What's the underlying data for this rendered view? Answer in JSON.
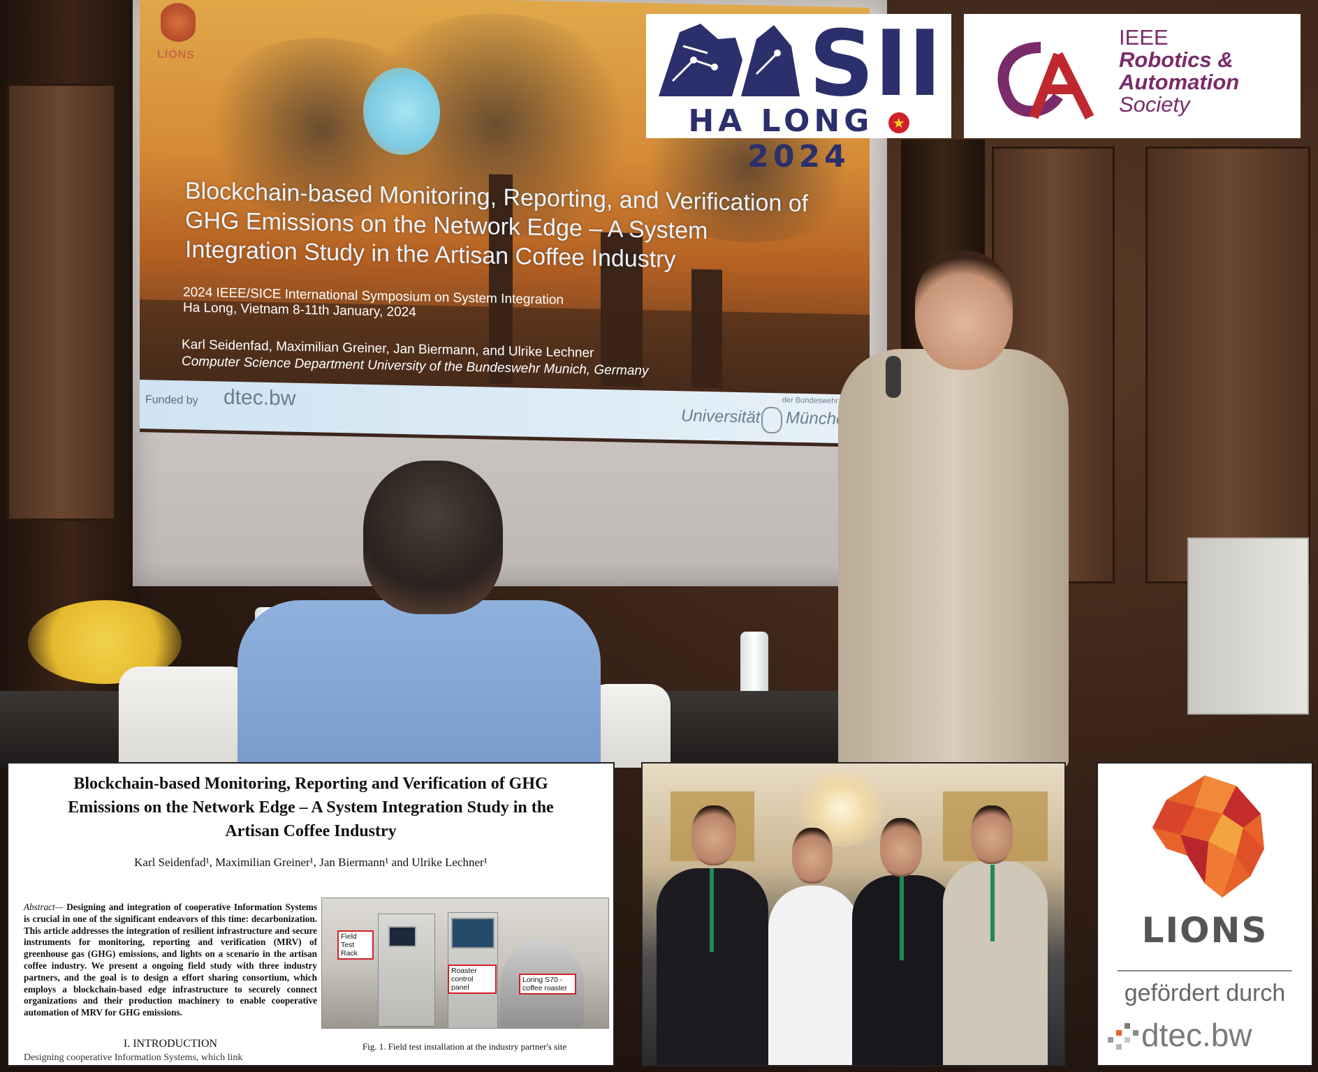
{
  "slide": {
    "logo_text": "LIONS",
    "title_lines": [
      "Blockchain-based Monitoring, Reporting, and Verification of",
      "GHG Emissions on the Network Edge – A System",
      "Integration Study in the Artisan Coffee Industry"
    ],
    "event_lines": [
      "2024 IEEE/SICE International Symposium on System Integration",
      "Ha Long, Vietnam 8-11th January, 2024"
    ],
    "authors": "Karl Seidenfad, Maximilian Greiner, Jan Biermann, and Ulrike Lechner",
    "affiliation": "Computer Science Department University of the Bundeswehr Munich, Germany",
    "funded_by": "Funded by",
    "funder_name": "dtec.bw",
    "university_left": "Universität",
    "university_right": "München",
    "university_top": "der Bundeswehr"
  },
  "sii_logo": {
    "mark_text": "SII",
    "place": "HA LONG",
    "year": "2024"
  },
  "ras_logo": {
    "lines": [
      "IEEE",
      "Robotics &",
      "Automation",
      "Society"
    ]
  },
  "paper": {
    "title_lines": [
      "Blockchain-based Monitoring, Reporting and Verification of GHG",
      "Emissions on the Network Edge – A System Integration Study in the",
      "Artisan Coffee Industry"
    ],
    "authors": "Karl Seidenfad¹, Maximilian Greiner¹, Jan Biermann¹ and Ulrike Lechner¹",
    "abstract_label": "Abstract—",
    "abstract_text": "Designing and integration of cooperative Information Systems is crucial in one of the significant endeavors of this time: decarbonization. This article addresses the integration of resilient infrastructure and secure instruments for monitoring, reporting and verification (MRV) of greenhouse gas (GHG) emissions, and lights on a scenario in the artisan coffee industry. We present a ongoing field study with three industry partners, and the goal is to design a effort sharing consortium, which employs a blockchain-based edge infrastructure to securely connect organizations and their production machinery to enable cooperative automation of MRV for GHG emissions.",
    "section_heading": "I. INTRODUCTION",
    "trailing_text": "Designing cooperative Information Systems, which link",
    "figure_labels": [
      "Field Test Rack",
      "Roaster control panel",
      "Loring S70 - coffee roaster"
    ],
    "figure_caption": "Fig. 1.   Field test installation at the industry partner's site"
  },
  "lions_box": {
    "word": "LIONS",
    "funded_text": "gefördert durch",
    "funder": "dtec.bw"
  },
  "colors": {
    "sii_navy": "#2b2f6b",
    "ras_purple": "#7a2b6a",
    "lions_orange": "#e8632a",
    "lions_red": "#c52b2b"
  }
}
